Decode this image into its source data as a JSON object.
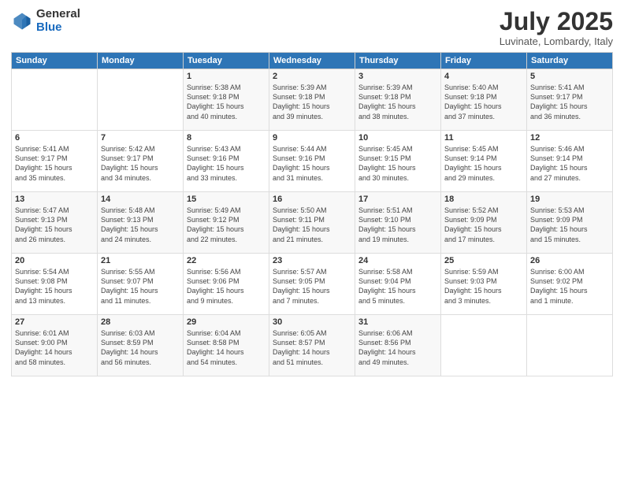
{
  "header": {
    "logo_general": "General",
    "logo_blue": "Blue",
    "month_title": "July 2025",
    "location": "Luvinate, Lombardy, Italy"
  },
  "days_of_week": [
    "Sunday",
    "Monday",
    "Tuesday",
    "Wednesday",
    "Thursday",
    "Friday",
    "Saturday"
  ],
  "weeks": [
    [
      {
        "day": "",
        "info": ""
      },
      {
        "day": "",
        "info": ""
      },
      {
        "day": "1",
        "info": "Sunrise: 5:38 AM\nSunset: 9:18 PM\nDaylight: 15 hours\nand 40 minutes."
      },
      {
        "day": "2",
        "info": "Sunrise: 5:39 AM\nSunset: 9:18 PM\nDaylight: 15 hours\nand 39 minutes."
      },
      {
        "day": "3",
        "info": "Sunrise: 5:39 AM\nSunset: 9:18 PM\nDaylight: 15 hours\nand 38 minutes."
      },
      {
        "day": "4",
        "info": "Sunrise: 5:40 AM\nSunset: 9:18 PM\nDaylight: 15 hours\nand 37 minutes."
      },
      {
        "day": "5",
        "info": "Sunrise: 5:41 AM\nSunset: 9:17 PM\nDaylight: 15 hours\nand 36 minutes."
      }
    ],
    [
      {
        "day": "6",
        "info": "Sunrise: 5:41 AM\nSunset: 9:17 PM\nDaylight: 15 hours\nand 35 minutes."
      },
      {
        "day": "7",
        "info": "Sunrise: 5:42 AM\nSunset: 9:17 PM\nDaylight: 15 hours\nand 34 minutes."
      },
      {
        "day": "8",
        "info": "Sunrise: 5:43 AM\nSunset: 9:16 PM\nDaylight: 15 hours\nand 33 minutes."
      },
      {
        "day": "9",
        "info": "Sunrise: 5:44 AM\nSunset: 9:16 PM\nDaylight: 15 hours\nand 31 minutes."
      },
      {
        "day": "10",
        "info": "Sunrise: 5:45 AM\nSunset: 9:15 PM\nDaylight: 15 hours\nand 30 minutes."
      },
      {
        "day": "11",
        "info": "Sunrise: 5:45 AM\nSunset: 9:14 PM\nDaylight: 15 hours\nand 29 minutes."
      },
      {
        "day": "12",
        "info": "Sunrise: 5:46 AM\nSunset: 9:14 PM\nDaylight: 15 hours\nand 27 minutes."
      }
    ],
    [
      {
        "day": "13",
        "info": "Sunrise: 5:47 AM\nSunset: 9:13 PM\nDaylight: 15 hours\nand 26 minutes."
      },
      {
        "day": "14",
        "info": "Sunrise: 5:48 AM\nSunset: 9:13 PM\nDaylight: 15 hours\nand 24 minutes."
      },
      {
        "day": "15",
        "info": "Sunrise: 5:49 AM\nSunset: 9:12 PM\nDaylight: 15 hours\nand 22 minutes."
      },
      {
        "day": "16",
        "info": "Sunrise: 5:50 AM\nSunset: 9:11 PM\nDaylight: 15 hours\nand 21 minutes."
      },
      {
        "day": "17",
        "info": "Sunrise: 5:51 AM\nSunset: 9:10 PM\nDaylight: 15 hours\nand 19 minutes."
      },
      {
        "day": "18",
        "info": "Sunrise: 5:52 AM\nSunset: 9:09 PM\nDaylight: 15 hours\nand 17 minutes."
      },
      {
        "day": "19",
        "info": "Sunrise: 5:53 AM\nSunset: 9:09 PM\nDaylight: 15 hours\nand 15 minutes."
      }
    ],
    [
      {
        "day": "20",
        "info": "Sunrise: 5:54 AM\nSunset: 9:08 PM\nDaylight: 15 hours\nand 13 minutes."
      },
      {
        "day": "21",
        "info": "Sunrise: 5:55 AM\nSunset: 9:07 PM\nDaylight: 15 hours\nand 11 minutes."
      },
      {
        "day": "22",
        "info": "Sunrise: 5:56 AM\nSunset: 9:06 PM\nDaylight: 15 hours\nand 9 minutes."
      },
      {
        "day": "23",
        "info": "Sunrise: 5:57 AM\nSunset: 9:05 PM\nDaylight: 15 hours\nand 7 minutes."
      },
      {
        "day": "24",
        "info": "Sunrise: 5:58 AM\nSunset: 9:04 PM\nDaylight: 15 hours\nand 5 minutes."
      },
      {
        "day": "25",
        "info": "Sunrise: 5:59 AM\nSunset: 9:03 PM\nDaylight: 15 hours\nand 3 minutes."
      },
      {
        "day": "26",
        "info": "Sunrise: 6:00 AM\nSunset: 9:02 PM\nDaylight: 15 hours\nand 1 minute."
      }
    ],
    [
      {
        "day": "27",
        "info": "Sunrise: 6:01 AM\nSunset: 9:00 PM\nDaylight: 14 hours\nand 58 minutes."
      },
      {
        "day": "28",
        "info": "Sunrise: 6:03 AM\nSunset: 8:59 PM\nDaylight: 14 hours\nand 56 minutes."
      },
      {
        "day": "29",
        "info": "Sunrise: 6:04 AM\nSunset: 8:58 PM\nDaylight: 14 hours\nand 54 minutes."
      },
      {
        "day": "30",
        "info": "Sunrise: 6:05 AM\nSunset: 8:57 PM\nDaylight: 14 hours\nand 51 minutes."
      },
      {
        "day": "31",
        "info": "Sunrise: 6:06 AM\nSunset: 8:56 PM\nDaylight: 14 hours\nand 49 minutes."
      },
      {
        "day": "",
        "info": ""
      },
      {
        "day": "",
        "info": ""
      }
    ]
  ]
}
